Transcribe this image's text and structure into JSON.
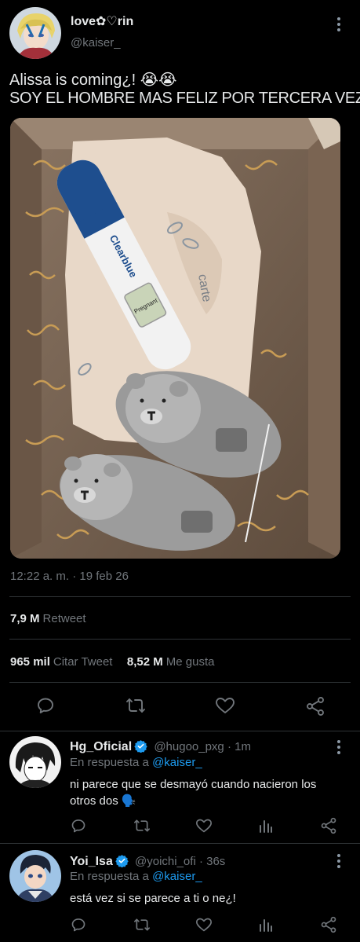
{
  "tweet": {
    "display_name": "love✿♡rin",
    "handle": "@kaiser_",
    "line1": "Alissa is coming¿! 😭😭",
    "line2": "SOY EL HOMBRE MAS FELIZ POR TERCERA VEZ",
    "timestamp": "12:22 a. m. · 19 feb 26",
    "retweets_value": "7,9 M",
    "retweets_label": "Retweet",
    "quotes_value": "965 mil",
    "quotes_label": "Citar Tweet",
    "likes_value": "8,52 M",
    "likes_label": "Me gusta",
    "image_text": {
      "brand": "Clearblue",
      "result": "Pregnant",
      "onesie_brand": "carte"
    }
  },
  "replies": [
    {
      "display_name": "Hg_Oficial",
      "handle_time": "@hugoo_pxg · 1m",
      "reply_prefix": "En respuesta a",
      "reply_to": "@kaiser_",
      "text": "ni parece que se desmayó cuando nacieron los otros dos 🗣️"
    },
    {
      "display_name": "Yoi_Isa",
      "handle_time": "@yoichi_ofi · 36s",
      "reply_prefix": "En respuesta a",
      "reply_to": "@kaiser_",
      "text": "está vez si se parece a ti o ne¿!"
    }
  ],
  "colors": {
    "background": "#000000",
    "text": "#e7e9ea",
    "muted": "#71767b",
    "link": "#1d9bf0",
    "divider": "#2f3336",
    "verified": "#1d9bf0"
  },
  "icons": [
    "more-icon",
    "reply-icon",
    "retweet-icon",
    "like-icon",
    "share-icon",
    "analytics-icon",
    "verified-badge-icon"
  ]
}
